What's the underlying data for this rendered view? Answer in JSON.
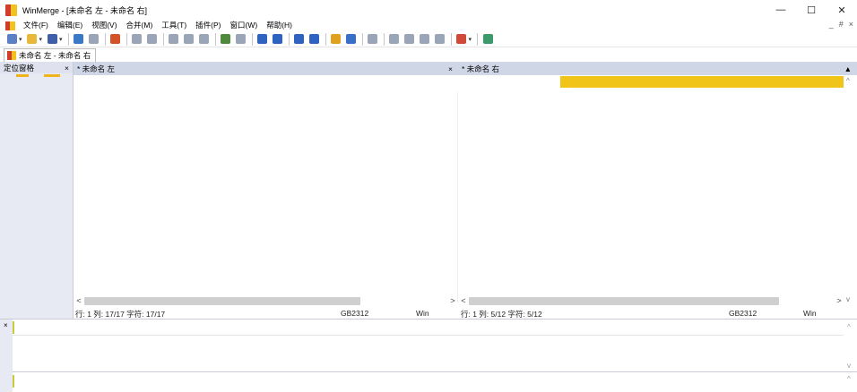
{
  "window": {
    "title": "WinMerge - [未命名 左 - 未命名 右]",
    "controls": {
      "minimize": "—",
      "maximize": "☐",
      "close": "✕"
    }
  },
  "menu": {
    "items": [
      "文件(F)",
      "编辑(E)",
      "视图(V)",
      "合并(M)",
      "工具(T)",
      "插件(P)",
      "窗口(W)",
      "帮助(H)"
    ],
    "mdi_controls": [
      "_",
      "#",
      "×"
    ]
  },
  "toolbar": {
    "buttons": [
      {
        "icon": "new-document-icon",
        "color": "#5a7fc4"
      },
      {
        "icon": "open-folder-icon",
        "color": "#e8b83a"
      },
      {
        "icon": "save-icon",
        "color": "#3f5fa8"
      },
      {
        "icon": "undo-icon",
        "color": "#3a78c8"
      },
      {
        "icon": "redo-icon",
        "color": "#9aa6b8"
      },
      {
        "icon": "refresh-icon",
        "color": "#d2532a"
      },
      {
        "icon": "prev-diff-icon",
        "color": "#9aa6b8"
      },
      {
        "icon": "next-diff-icon",
        "color": "#9aa6b8"
      },
      {
        "icon": "first-diff-icon",
        "color": "#9aa6b8"
      },
      {
        "icon": "last-diff-icon",
        "color": "#9aa6b8"
      },
      {
        "icon": "current-diff-icon",
        "color": "#9aa6b8"
      },
      {
        "icon": "copy-right-icon",
        "color": "#4f8a3c"
      },
      {
        "icon": "copy-left-icon",
        "color": "#9aa6b8"
      },
      {
        "icon": "move-right-icon",
        "color": "#2e63c2"
      },
      {
        "icon": "move-left-icon",
        "color": "#2e63c2"
      },
      {
        "icon": "copy-all-right-icon",
        "color": "#2e63c2"
      },
      {
        "icon": "copy-all-left-icon",
        "color": "#2e63c2"
      },
      {
        "icon": "merge-icon",
        "color": "#e0a020"
      },
      {
        "icon": "merge-all-icon",
        "color": "#3a6fc8"
      },
      {
        "icon": "compare-icon",
        "color": "#9aa6b8"
      },
      {
        "icon": "prev-conflict-icon",
        "color": "#9aa6b8"
      },
      {
        "icon": "next-conflict-icon",
        "color": "#9aa6b8"
      },
      {
        "icon": "prev-file-icon",
        "color": "#9aa6b8"
      },
      {
        "icon": "next-file-icon",
        "color": "#9aa6b8"
      },
      {
        "icon": "options-icon",
        "color": "#d04a3a"
      },
      {
        "icon": "sync-icon",
        "color": "#3a9a6a"
      }
    ]
  },
  "doc_tab": {
    "label": "未命名 左 - 未命名 右"
  },
  "location_pane": {
    "title": "定位窗格",
    "close": "×"
  },
  "left_pane": {
    "header": "* 未命名 左",
    "close": "×",
    "status": {
      "position": "行: 1  列: 17/17  字符: 17/17",
      "encoding": "GB2312",
      "eol": "Win"
    }
  },
  "right_pane": {
    "header": "* 未命名 右",
    "scroll_marker": "▲",
    "status": {
      "position": "行: 1  列: 5/12  字符: 5/12",
      "encoding": "GB2312",
      "eol": "Win"
    }
  },
  "bottom_pane": {
    "close": "×"
  },
  "colors": {
    "diff_highlight": "#f0c419",
    "pane_header": "#cfd6e6",
    "location_pane_bg": "#e7e9f3"
  }
}
